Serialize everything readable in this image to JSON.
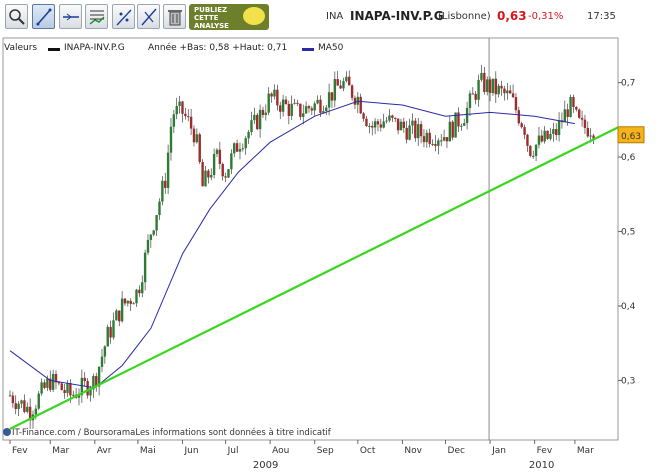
{
  "toolbar": {
    "buttons": [
      {
        "name": "zoom-tool-button",
        "icon": "zoom-icon"
      },
      {
        "name": "trendline-tool-button",
        "icon": "trendline-icon"
      },
      {
        "name": "horizontal-line-tool-button",
        "icon": "horizontal-line-icon"
      },
      {
        "name": "indicators-tool-button",
        "icon": "indicators-icon"
      },
      {
        "name": "fibonacci-tool-button",
        "icon": "fibonacci-icon"
      },
      {
        "name": "channel-tool-button",
        "icon": "channel-icon"
      },
      {
        "name": "delete-tool-button",
        "icon": "trash-icon"
      }
    ],
    "ad_badge": {
      "line1": "PUBLIEZ",
      "line2": "CETTE",
      "line3": "ANALYSE"
    }
  },
  "header": {
    "code": "INA",
    "name": "INAPA-INV.P.G",
    "exchange": "(Lisbonne)",
    "price": "0,63",
    "variation": "-0,31%",
    "time": "17:35"
  },
  "legend": {
    "title": "Valeurs",
    "series_label": "INAPA-INV.P.G",
    "stats": "Année +Bas: 0,58 +Haut: 0,71",
    "ma_label": "MA50"
  },
  "footer": {
    "text": "IT-Finance.com / BoursoramaLes informations sont données à titre indicatif"
  },
  "colors": {
    "up": "#2f7a35",
    "down": "#9c2d2a",
    "ma": "#2a2aa8",
    "trendline": "#39d61f",
    "price_tag": "#f7b31a",
    "header_price": "#d8161b"
  },
  "chart_data": {
    "type": "candlestick",
    "y_ticks": [
      "0,7",
      "0,6",
      "0,5",
      "0,4",
      "0,3"
    ],
    "ylim": [
      0.22,
      0.76
    ],
    "current_price_label": "0,63",
    "x_months": [
      "Fev",
      "Mar",
      "Avr",
      "Mai",
      "Jun",
      "Jul",
      "Aou",
      "Sep",
      "Oct",
      "Nov",
      "Dec",
      "Jan",
      "Fev",
      "Mar"
    ],
    "x_years": [
      "2009",
      "2010"
    ],
    "year_divider_after_month": "Dec",
    "close_path": [
      [
        "2009-02-01",
        0.28
      ],
      [
        "2009-02-15",
        0.26
      ],
      [
        "2009-03-01",
        0.3
      ],
      [
        "2009-03-15",
        0.28
      ],
      [
        "2009-04-01",
        0.3
      ],
      [
        "2009-04-10",
        0.36
      ],
      [
        "2009-04-20",
        0.4
      ],
      [
        "2009-05-01",
        0.42
      ],
      [
        "2009-05-10",
        0.5
      ],
      [
        "2009-05-20",
        0.57
      ],
      [
        "2009-05-25",
        0.66
      ],
      [
        "2009-06-01",
        0.66
      ],
      [
        "2009-06-10",
        0.63
      ],
      [
        "2009-06-15",
        0.56
      ],
      [
        "2009-06-25",
        0.6
      ],
      [
        "2009-07-01",
        0.58
      ],
      [
        "2009-07-10",
        0.62
      ],
      [
        "2009-07-20",
        0.64
      ],
      [
        "2009-08-01",
        0.68
      ],
      [
        "2009-08-10",
        0.67
      ],
      [
        "2009-08-20",
        0.66
      ],
      [
        "2009-09-01",
        0.67
      ],
      [
        "2009-09-10",
        0.68
      ],
      [
        "2009-09-20",
        0.7
      ],
      [
        "2009-10-01",
        0.68
      ],
      [
        "2009-10-10",
        0.64
      ],
      [
        "2009-10-20",
        0.65
      ],
      [
        "2009-11-01",
        0.64
      ],
      [
        "2009-11-15",
        0.63
      ],
      [
        "2009-12-01",
        0.63
      ],
      [
        "2009-12-15",
        0.66
      ],
      [
        "2009-12-25",
        0.7
      ],
      [
        "2010-01-05",
        0.69
      ],
      [
        "2010-01-15",
        0.68
      ],
      [
        "2010-01-25",
        0.64
      ],
      [
        "2010-01-28",
        0.61
      ],
      [
        "2010-02-05",
        0.62
      ],
      [
        "2010-02-15",
        0.63
      ],
      [
        "2010-02-25",
        0.67
      ],
      [
        "2010-03-05",
        0.64
      ],
      [
        "2010-03-15",
        0.64
      ]
    ],
    "ma50": [
      [
        "2009-02-01",
        0.34
      ],
      [
        "2009-03-01",
        0.3
      ],
      [
        "2009-04-01",
        0.29
      ],
      [
        "2009-04-20",
        0.32
      ],
      [
        "2009-05-10",
        0.37
      ],
      [
        "2009-06-01",
        0.47
      ],
      [
        "2009-06-20",
        0.53
      ],
      [
        "2009-07-10",
        0.58
      ],
      [
        "2009-08-01",
        0.62
      ],
      [
        "2009-09-01",
        0.655
      ],
      [
        "2009-10-01",
        0.675
      ],
      [
        "2009-11-01",
        0.67
      ],
      [
        "2009-12-01",
        0.655
      ],
      [
        "2010-01-01",
        0.66
      ],
      [
        "2010-02-01",
        0.655
      ],
      [
        "2010-03-01",
        0.645
      ]
    ],
    "trendline": [
      [
        "2009-02-01",
        0.235
      ],
      [
        "2010-03-31",
        0.64
      ]
    ]
  }
}
